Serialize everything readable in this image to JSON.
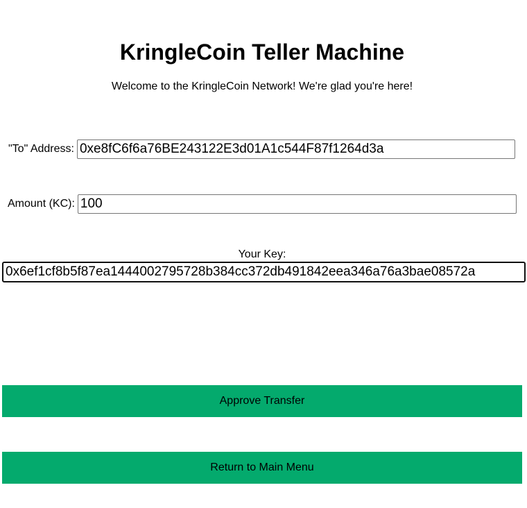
{
  "title": "KringleCoin Teller Machine",
  "welcome": "Welcome to the KringleCoin Network! We're glad you're here!",
  "form": {
    "to_label": "\"To\" Address:",
    "to_value": "0xe8fC6f6a76BE243122E3d01A1c544F87f1264d3a",
    "amount_label": "Amount (KC):",
    "amount_value": "100",
    "key_label": "Your Key:",
    "key_value": "0x6ef1cf8b5f87ea1444002795728b384cc372db491842eea346a76a3bae08572a"
  },
  "buttons": {
    "approve": "Approve Transfer",
    "return": "Return to Main Menu"
  },
  "colors": {
    "button": "#04AA6D"
  }
}
